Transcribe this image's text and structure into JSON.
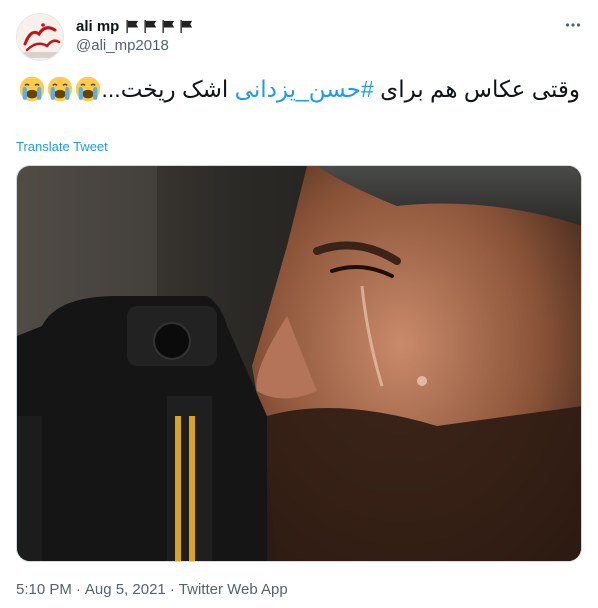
{
  "user": {
    "display_name": "ali mp",
    "handle": "@ali_mp2018",
    "flag_icons": [
      "black-flag-icon",
      "black-flag-icon",
      "black-flag-icon",
      "black-flag-icon"
    ],
    "avatar_text": "ایران"
  },
  "tweet": {
    "text_before": "وقتی عکاس هم برای ",
    "hashtag": "#حسن_یزدانی",
    "text_after": " اشک ریخت...",
    "emojis": [
      "loudly-crying-face-icon",
      "loudly-crying-face-icon",
      "loudly-crying-face-icon"
    ],
    "translate_label": "Translate Tweet"
  },
  "meta": {
    "time": "5:10 PM",
    "date": "Aug 5, 2021",
    "source": "Twitter Web App",
    "separator": "·"
  },
  "colors": {
    "link": "#1d9bf0",
    "secondary_text": "#536471",
    "primary_text": "#0f1419"
  }
}
